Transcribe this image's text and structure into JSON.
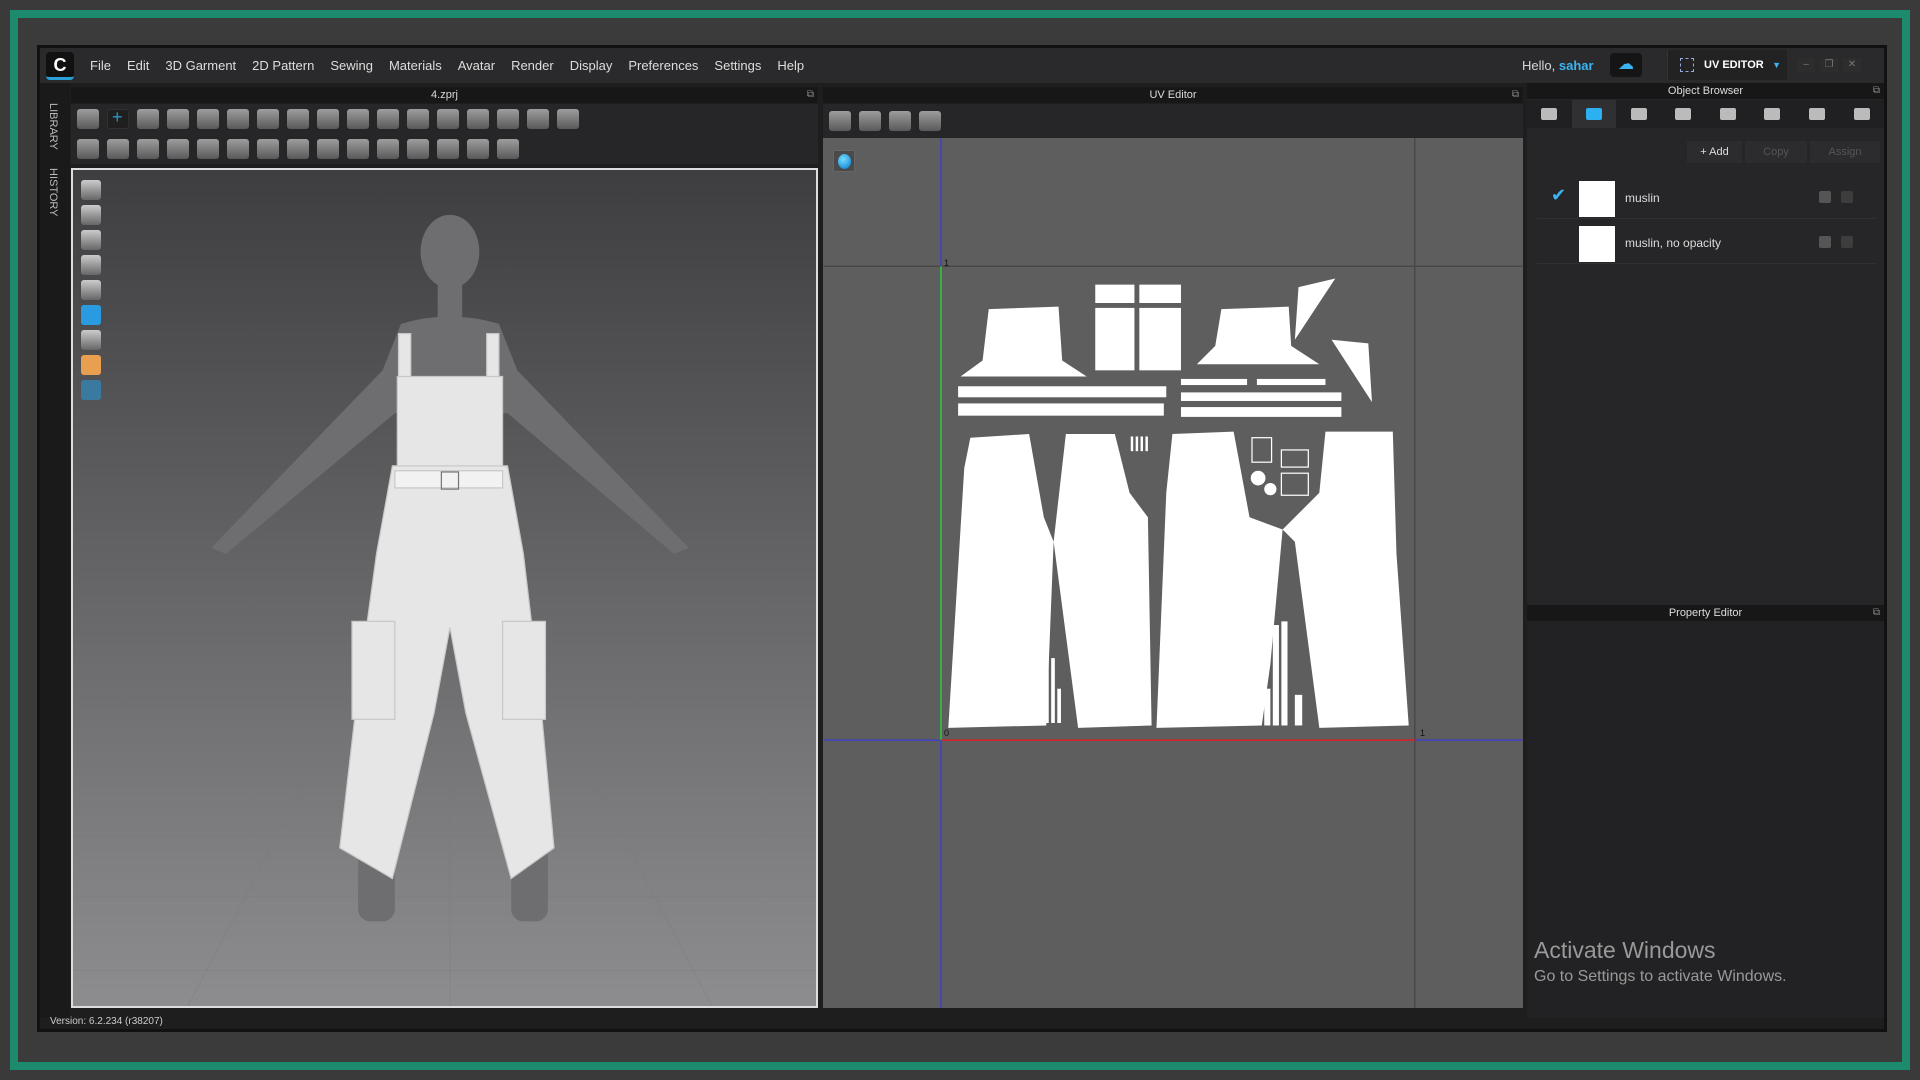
{
  "menu": {
    "items": [
      "File",
      "Edit",
      "3D Garment",
      "2D Pattern",
      "Sewing",
      "Materials",
      "Avatar",
      "Render",
      "Display",
      "Preferences",
      "Settings",
      "Help"
    ],
    "greeting": "Hello,",
    "user": "sahar",
    "mode": "UV EDITOR"
  },
  "side": {
    "library": "LIBRARY",
    "history": "HISTORY"
  },
  "viewport3d": {
    "title": "4.zprj"
  },
  "toolbar3d_row1": [
    "arrow-down-icon",
    "select-move-icon",
    "transform-pattern-icon",
    "garment-icon",
    "fold-icon",
    "segment-icon",
    "curve-icon",
    "sew-icon",
    "pin-icon",
    "tack-icon",
    "export-icon",
    "shirt-icon",
    "flip-icon",
    "mirror-icon",
    "avatar-icon",
    "mesh-icon",
    "arrange-icon"
  ],
  "toolbar3d_row2": [
    "edit-point-icon",
    "needle-icon",
    "needle2-icon",
    "texture-icon",
    "pattern-icon",
    "check-icon",
    "button-icon",
    "button2-icon",
    "buttonhole-icon",
    "zipper-icon",
    "tape-icon",
    "tape2-icon",
    "fabric-icon",
    "fabric2-icon",
    "shrink-icon"
  ],
  "uv": {
    "title": "UV Editor",
    "tools": [
      "camera-uv-icon",
      "camera-garment-icon",
      "move-garment-icon",
      "garment-pair-icon"
    ],
    "axis_top": "1",
    "axis_origin": "0",
    "axis_right": "1"
  },
  "object_browser": {
    "title": "Object Browser",
    "tabs": [
      "list-icon",
      "fabric-icon",
      "button-icon",
      "topstitch-icon",
      "line-icon",
      "zigzag-icon",
      "buildings-icon",
      "ruler-icon"
    ],
    "add": "+ Add",
    "copy": "Copy",
    "assign": "Assign",
    "materials": [
      {
        "name": "muslin",
        "checked": true
      },
      {
        "name": "muslin, no opacity",
        "checked": false
      }
    ]
  },
  "property_editor": {
    "title": "Property Editor"
  },
  "watermark": {
    "line1": "Activate Windows",
    "line2": "Go to Settings to activate Windows."
  },
  "status": {
    "version": "Version: 6.2.234 (r38207)"
  },
  "colors": {
    "accent": "#2bb0f0",
    "frame": "#1d8a6e"
  }
}
